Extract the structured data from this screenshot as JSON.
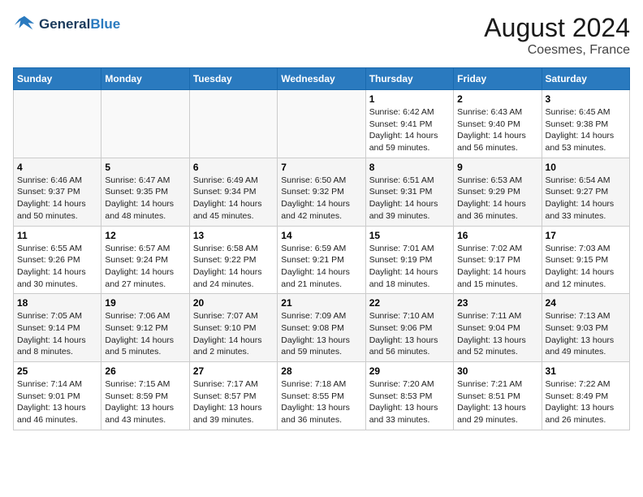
{
  "header": {
    "logo_line1": "General",
    "logo_line2": "Blue",
    "month_year": "August 2024",
    "location": "Coesmes, France"
  },
  "weekdays": [
    "Sunday",
    "Monday",
    "Tuesday",
    "Wednesday",
    "Thursday",
    "Friday",
    "Saturday"
  ],
  "weeks": [
    [
      {
        "day": "",
        "info": ""
      },
      {
        "day": "",
        "info": ""
      },
      {
        "day": "",
        "info": ""
      },
      {
        "day": "",
        "info": ""
      },
      {
        "day": "1",
        "info": "Sunrise: 6:42 AM\nSunset: 9:41 PM\nDaylight: 14 hours\nand 59 minutes."
      },
      {
        "day": "2",
        "info": "Sunrise: 6:43 AM\nSunset: 9:40 PM\nDaylight: 14 hours\nand 56 minutes."
      },
      {
        "day": "3",
        "info": "Sunrise: 6:45 AM\nSunset: 9:38 PM\nDaylight: 14 hours\nand 53 minutes."
      }
    ],
    [
      {
        "day": "4",
        "info": "Sunrise: 6:46 AM\nSunset: 9:37 PM\nDaylight: 14 hours\nand 50 minutes."
      },
      {
        "day": "5",
        "info": "Sunrise: 6:47 AM\nSunset: 9:35 PM\nDaylight: 14 hours\nand 48 minutes."
      },
      {
        "day": "6",
        "info": "Sunrise: 6:49 AM\nSunset: 9:34 PM\nDaylight: 14 hours\nand 45 minutes."
      },
      {
        "day": "7",
        "info": "Sunrise: 6:50 AM\nSunset: 9:32 PM\nDaylight: 14 hours\nand 42 minutes."
      },
      {
        "day": "8",
        "info": "Sunrise: 6:51 AM\nSunset: 9:31 PM\nDaylight: 14 hours\nand 39 minutes."
      },
      {
        "day": "9",
        "info": "Sunrise: 6:53 AM\nSunset: 9:29 PM\nDaylight: 14 hours\nand 36 minutes."
      },
      {
        "day": "10",
        "info": "Sunrise: 6:54 AM\nSunset: 9:27 PM\nDaylight: 14 hours\nand 33 minutes."
      }
    ],
    [
      {
        "day": "11",
        "info": "Sunrise: 6:55 AM\nSunset: 9:26 PM\nDaylight: 14 hours\nand 30 minutes."
      },
      {
        "day": "12",
        "info": "Sunrise: 6:57 AM\nSunset: 9:24 PM\nDaylight: 14 hours\nand 27 minutes."
      },
      {
        "day": "13",
        "info": "Sunrise: 6:58 AM\nSunset: 9:22 PM\nDaylight: 14 hours\nand 24 minutes."
      },
      {
        "day": "14",
        "info": "Sunrise: 6:59 AM\nSunset: 9:21 PM\nDaylight: 14 hours\nand 21 minutes."
      },
      {
        "day": "15",
        "info": "Sunrise: 7:01 AM\nSunset: 9:19 PM\nDaylight: 14 hours\nand 18 minutes."
      },
      {
        "day": "16",
        "info": "Sunrise: 7:02 AM\nSunset: 9:17 PM\nDaylight: 14 hours\nand 15 minutes."
      },
      {
        "day": "17",
        "info": "Sunrise: 7:03 AM\nSunset: 9:15 PM\nDaylight: 14 hours\nand 12 minutes."
      }
    ],
    [
      {
        "day": "18",
        "info": "Sunrise: 7:05 AM\nSunset: 9:14 PM\nDaylight: 14 hours\nand 8 minutes."
      },
      {
        "day": "19",
        "info": "Sunrise: 7:06 AM\nSunset: 9:12 PM\nDaylight: 14 hours\nand 5 minutes."
      },
      {
        "day": "20",
        "info": "Sunrise: 7:07 AM\nSunset: 9:10 PM\nDaylight: 14 hours\nand 2 minutes."
      },
      {
        "day": "21",
        "info": "Sunrise: 7:09 AM\nSunset: 9:08 PM\nDaylight: 13 hours\nand 59 minutes."
      },
      {
        "day": "22",
        "info": "Sunrise: 7:10 AM\nSunset: 9:06 PM\nDaylight: 13 hours\nand 56 minutes."
      },
      {
        "day": "23",
        "info": "Sunrise: 7:11 AM\nSunset: 9:04 PM\nDaylight: 13 hours\nand 52 minutes."
      },
      {
        "day": "24",
        "info": "Sunrise: 7:13 AM\nSunset: 9:03 PM\nDaylight: 13 hours\nand 49 minutes."
      }
    ],
    [
      {
        "day": "25",
        "info": "Sunrise: 7:14 AM\nSunset: 9:01 PM\nDaylight: 13 hours\nand 46 minutes."
      },
      {
        "day": "26",
        "info": "Sunrise: 7:15 AM\nSunset: 8:59 PM\nDaylight: 13 hours\nand 43 minutes."
      },
      {
        "day": "27",
        "info": "Sunrise: 7:17 AM\nSunset: 8:57 PM\nDaylight: 13 hours\nand 39 minutes."
      },
      {
        "day": "28",
        "info": "Sunrise: 7:18 AM\nSunset: 8:55 PM\nDaylight: 13 hours\nand 36 minutes."
      },
      {
        "day": "29",
        "info": "Sunrise: 7:20 AM\nSunset: 8:53 PM\nDaylight: 13 hours\nand 33 minutes."
      },
      {
        "day": "30",
        "info": "Sunrise: 7:21 AM\nSunset: 8:51 PM\nDaylight: 13 hours\nand 29 minutes."
      },
      {
        "day": "31",
        "info": "Sunrise: 7:22 AM\nSunset: 8:49 PM\nDaylight: 13 hours\nand 26 minutes."
      }
    ]
  ]
}
